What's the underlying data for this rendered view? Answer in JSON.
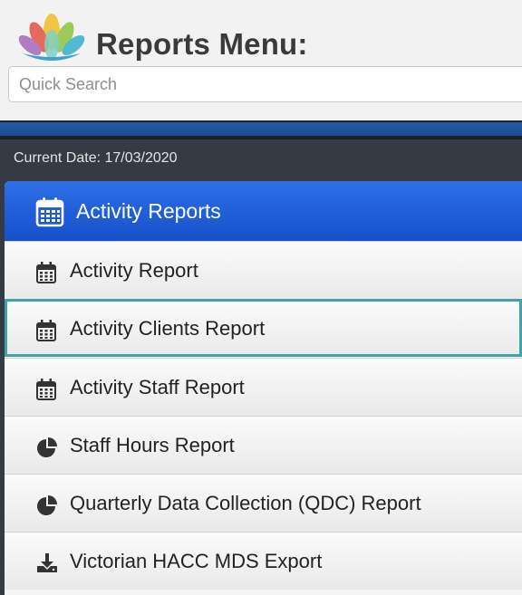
{
  "header": {
    "title": "Reports Menu:",
    "search_placeholder": "Quick Search"
  },
  "current_date": "Current Date: 17/03/2020",
  "menu": {
    "heading": {
      "label": "Activity Reports",
      "icon": "calendar-icon"
    },
    "items": [
      {
        "label": "Activity Report",
        "icon": "calendar-icon"
      },
      {
        "label": "Activity Clients Report",
        "icon": "calendar-icon",
        "focused": true
      },
      {
        "label": "Activity Staff Report",
        "icon": "calendar-icon"
      },
      {
        "label": "Staff Hours Report",
        "icon": "pie-chart-icon"
      },
      {
        "label": "Quarterly Data Collection (QDC) Report",
        "icon": "pie-chart-icon"
      },
      {
        "label": "Victorian HACC MDS Export",
        "icon": "download-icon"
      }
    ]
  },
  "colors": {
    "heading_blue": "#1f5fdc",
    "focus_outline": "#40a4a4",
    "dark_bar": "#353b43"
  }
}
